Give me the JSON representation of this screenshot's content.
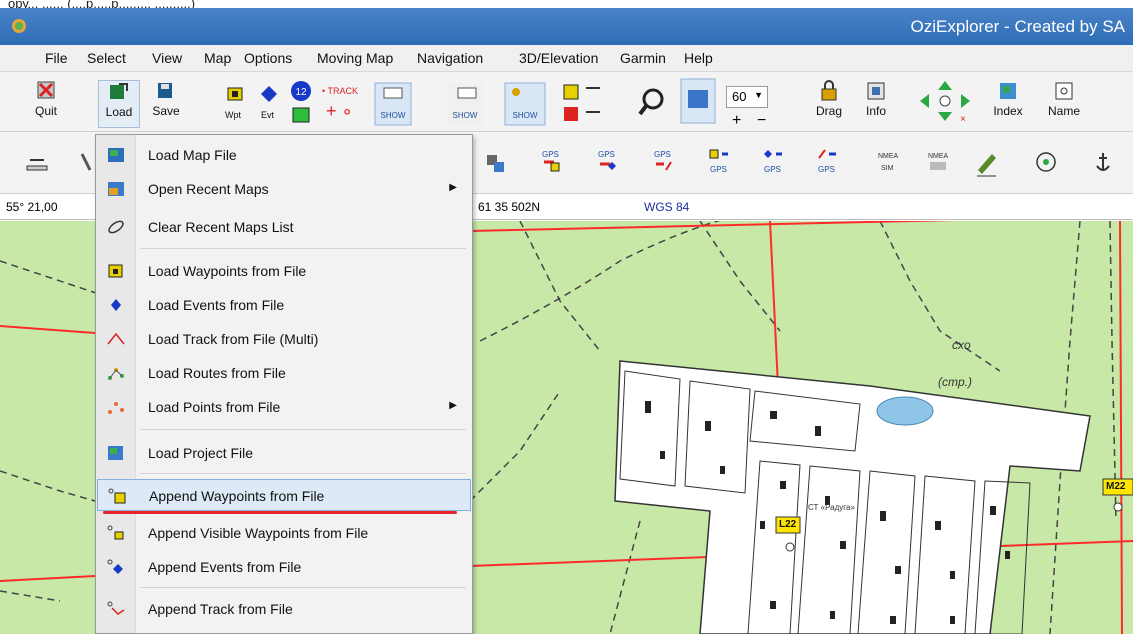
{
  "caption": "ору... ...... (....р.....р......... ..........)",
  "window": {
    "title": "OziExplorer - Created by SA"
  },
  "menubar": [
    "File",
    "Select",
    "View",
    "Map",
    "Options",
    "Moving Map",
    "Navigation",
    "3D/Elevation",
    "Garmin",
    "Help"
  ],
  "toolbar1": {
    "quit": "Quit",
    "load": "Load",
    "save": "Save",
    "wpt": "Wpt",
    "evt": "Evt",
    "track": "• TRACK",
    "zoom_value": "60",
    "drag": "Drag",
    "info": "Info",
    "index": "Index",
    "name": "Name"
  },
  "statusbar": {
    "coord_left": "55° 21,00",
    "coord_right": "61 35 502N",
    "datum": "WGS 84"
  },
  "dropdown": {
    "items": [
      {
        "label": "Load Map File"
      },
      {
        "label": "Open Recent Maps"
      },
      {
        "label": "Clear Recent Maps List"
      },
      {
        "label": "Load Waypoints from File"
      },
      {
        "label": "Load Events from File"
      },
      {
        "label": "Load Track from File (Multi)"
      },
      {
        "label": "Load Routes from File"
      },
      {
        "label": "Load Points from File"
      },
      {
        "label": "Load Project File"
      },
      {
        "label": "Append Waypoints from File"
      },
      {
        "label": "Append Visible Waypoints from File"
      },
      {
        "label": "Append Events from File"
      },
      {
        "label": "Append Track from File"
      }
    ]
  },
  "map": {
    "labels": {
      "cst": "cxo",
      "cmp": "(cmp.)",
      "ct": "СТ «Радуга»",
      "l22": "L22",
      "m22": "M22"
    }
  },
  "colors": {
    "accent": "#e8242d",
    "highlight": "#dde9f7",
    "map_green": "#c8e8a8",
    "road_red": "#ff2a2a"
  }
}
